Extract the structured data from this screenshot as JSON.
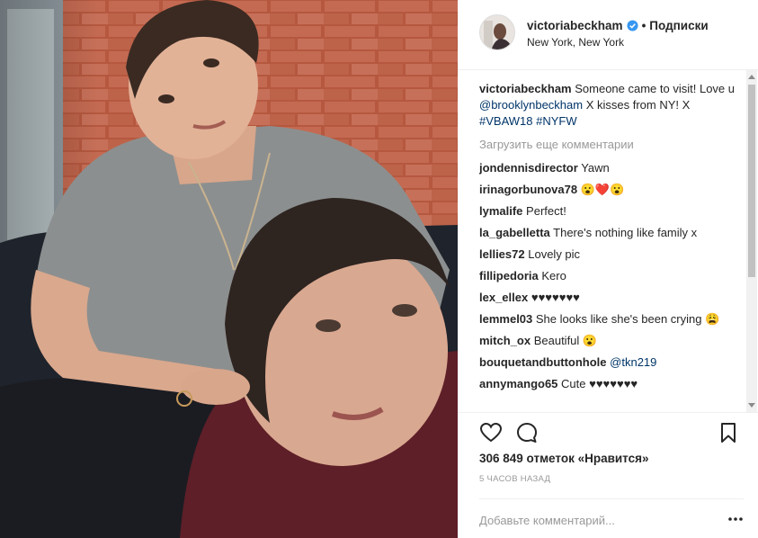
{
  "post": {
    "username": "victoriabeckham",
    "separator": "•",
    "follow_label": "Подписки",
    "location": "New York, New York"
  },
  "caption": {
    "username": "victoriabeckham",
    "text_1": "Someone came to visit! Love u ",
    "mention": "@brooklynbeckham",
    "text_2": " X kisses from NY! X ",
    "hashtag_1": "#VBAW18",
    "text_3": " ",
    "hashtag_2": "#NYFW"
  },
  "load_more_label": "Загрузить еще комментарии",
  "comments": [
    {
      "user": "jondennisdirector",
      "text": "Yawn"
    },
    {
      "user": "irinagorbunova78",
      "text": "😮❤️😮"
    },
    {
      "user": "lymalife",
      "text": "Perfect!"
    },
    {
      "user": "la_gabelletta",
      "text": "There's nothing like family x"
    },
    {
      "user": "lellies72",
      "text": "Lovely pic"
    },
    {
      "user": "fillipedoria",
      "text": "Kero"
    },
    {
      "user": "lex_ellex",
      "text": "♥♥♥♥♥♥♥"
    },
    {
      "user": "lemmel03",
      "text": "She looks like she's been crying 😩"
    },
    {
      "user": "mitch_ox",
      "text": "Beautiful 😮"
    },
    {
      "user": "bouquetandbuttonhole",
      "text": "",
      "mention": "@tkn219"
    },
    {
      "user": "annymango65",
      "text": "Cute ♥♥♥♥♥♥♥"
    }
  ],
  "likes_text": "306 849 отметок «Нравится»",
  "time_text": "5 часов назад",
  "add_comment_placeholder": "Добавьте комментарий...",
  "colors": {
    "link": "#003569",
    "verified": "#3897f0",
    "muted": "#999999"
  },
  "icons": [
    "verified-icon",
    "heart-icon",
    "comment-icon",
    "bookmark-icon",
    "more-icon"
  ]
}
